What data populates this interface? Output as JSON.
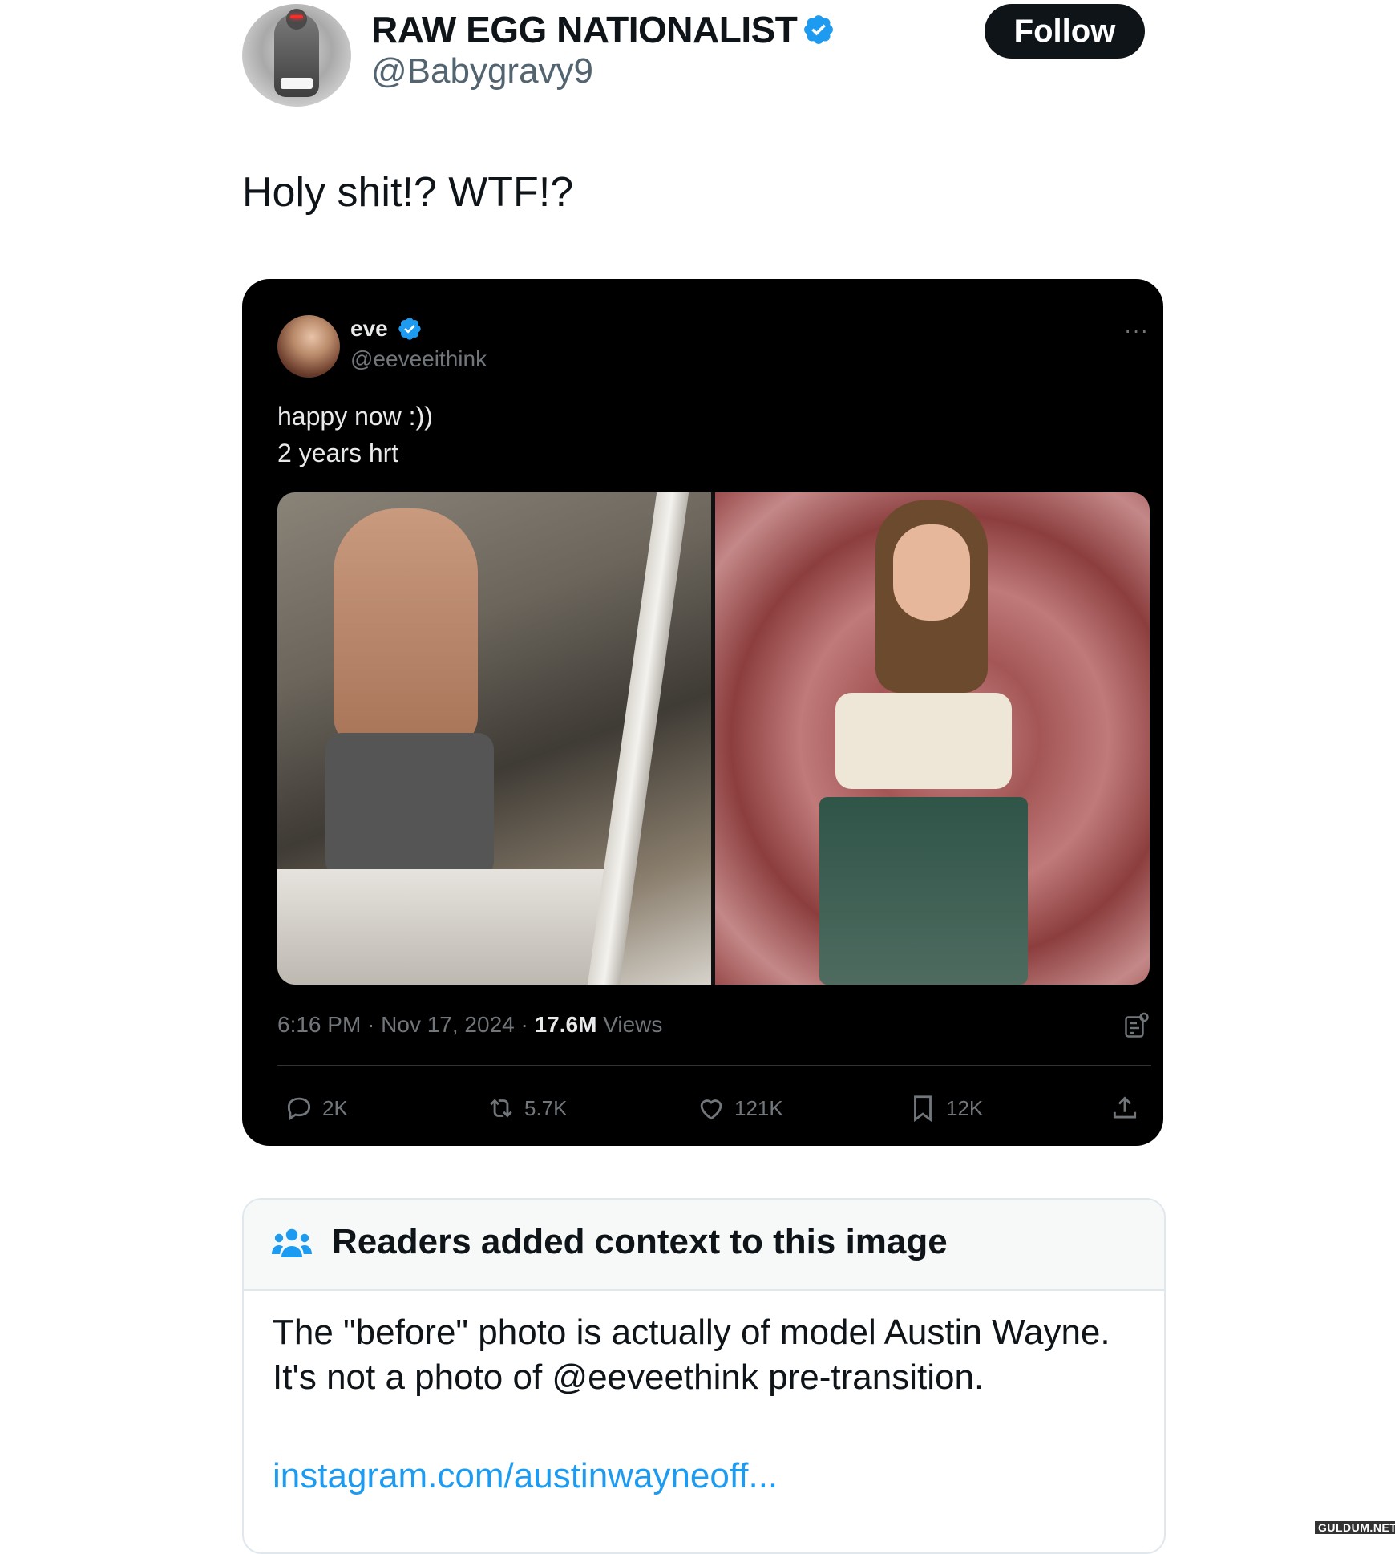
{
  "author": {
    "name": "RAW EGG NATIONALIST",
    "handle": "@Babygravy9",
    "follow_label": "Follow"
  },
  "tweet": {
    "text": "Holy shit!? WTF!?"
  },
  "quoted": {
    "name": "eve",
    "handle": "@eeveeithink",
    "more": "···",
    "text_line1": "happy now :))",
    "text_line2": "2 years hrt",
    "time": "6:16 PM · Nov 17, 2024 · ",
    "views_count": "17.6M",
    "views_label": " Views",
    "stats": {
      "replies": "2K",
      "reposts": "5.7K",
      "likes": "121K",
      "bookmarks": "12K"
    }
  },
  "note": {
    "title": "Readers added context to this image",
    "body": "The \"before\" photo is actually of model Austin Wayne. It's not a photo of @eeveethink pre-transition.",
    "link": "instagram.com/austinwayneoff..."
  },
  "watermark": "GULDUM.NET",
  "colors": {
    "verified_blue": "#1d9bf0",
    "link_blue": "#1d9bf0",
    "muted_gray": "#536471",
    "dark_bg": "#000000"
  },
  "icons": [
    "verified-icon",
    "more-icon",
    "analytics-icon",
    "reply-icon",
    "repost-icon",
    "like-icon",
    "bookmark-icon",
    "share-icon",
    "community-notes-icon"
  ]
}
